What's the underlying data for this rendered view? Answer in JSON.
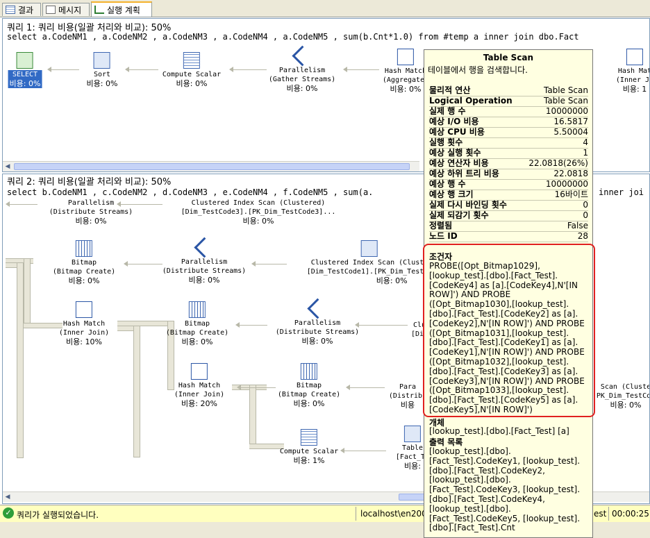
{
  "tabs": [
    {
      "label": "결과",
      "icon": "grid-icon"
    },
    {
      "label": "메시지",
      "icon": "message-icon"
    },
    {
      "label": "실행 계획",
      "icon": "plan-icon"
    }
  ],
  "query1": {
    "header": "쿼리 1: 쿼리 비용(일괄 처리와 비교): 50%",
    "sql": "select a.CodeNM1 , a.CodeNM2 , a.CodeNM3 , a.CodeNM4 , a.CodeNM5 , sum(b.Cnt*1.0) from #temp a inner join dbo.Fact",
    "nodes": [
      {
        "name": "SELECT",
        "cost": "비용: 0%",
        "icon": "select-icon"
      },
      {
        "name": "Sort",
        "cost": "비용: 0%",
        "icon": "sort-icon"
      },
      {
        "name": "Compute Scalar",
        "cost": "비용: 0%",
        "icon": "compute-scalar-icon"
      },
      {
        "name": "Parallelism",
        "sub": "(Gather Streams)",
        "cost": "비용: 0%",
        "icon": "parallelism-icon"
      },
      {
        "name": "Hash Match",
        "sub": "(Aggregate)",
        "cost": "비용: 0%",
        "icon": "hash-match-icon"
      },
      {
        "name": "Hash Mat",
        "sub": "(Inner Jo",
        "cost": "비용: 1",
        "icon": "hash-match-icon"
      }
    ]
  },
  "query2": {
    "header": "쿼리 2: 쿼리 비용(일괄 처리와 비교): 50%",
    "sql": "select b.CodeNM1 , c.CodeNM2 , d.CodeNM3 , e.CodeNM4 , f.CodeNM5 , sum(a.",
    "sql_tail": "inner joi",
    "nodes": {
      "par_top": {
        "name": "Parallelism",
        "sub": "(Distribute Streams)",
        "cost": "비용: 0%"
      },
      "cis_top": {
        "name": "Clustered Index Scan (Clustered)",
        "sub": "[Dim_TestCode3].[PK_Dim_TestCode3]...",
        "cost": "비용: 0%"
      },
      "bitmap1": {
        "name": "Bitmap",
        "sub": "(Bitmap Create)",
        "cost": "비용: 0%"
      },
      "par1": {
        "name": "Parallelism",
        "sub": "(Distribute Streams)",
        "cost": "비용: 0%"
      },
      "cis1": {
        "name": "Clustered Index Scan (Cluste",
        "sub": "[Dim_TestCode1].[PK_Dim_TestCo",
        "cost": "비용: 0%"
      },
      "hm1": {
        "name": "Hash Match",
        "sub": "(Inner Join)",
        "cost": "비용: 10%"
      },
      "bitmap2": {
        "name": "Bitmap",
        "sub": "(Bitmap Create)",
        "cost": "비용: 0%"
      },
      "par2": {
        "name": "Parallelism",
        "sub": "(Distribute Streams)",
        "cost": "비용: 0%"
      },
      "clu2": {
        "name": "Clu",
        "sub": "[Dim",
        "cost": ""
      },
      "hm2": {
        "name": "Hash Match",
        "sub": "(Inner Join)",
        "cost": "비용: 20%"
      },
      "bitmap3": {
        "name": "Bitmap",
        "sub": "(Bitmap Create)",
        "cost": "비용: 0%"
      },
      "para3": {
        "name": "Para",
        "sub": "(Distribu",
        "cost": "비용"
      },
      "scan_right": {
        "name": "Scan (Cluste",
        "sub": "PK_Dim_TestCod",
        "cost": "비용: 0%"
      },
      "cs": {
        "name": "Compute Scalar",
        "cost": "비용: 1%"
      },
      "table": {
        "name": "Table",
        "sub": "[Fact_Te",
        "cost": "비용:"
      }
    }
  },
  "tooltip": {
    "title": "Table Scan",
    "desc": "테이블에서 행을 검색합니다.",
    "rows": [
      {
        "k": "물리적 연산",
        "v": "Table Scan"
      },
      {
        "k": "Logical Operation",
        "v": "Table Scan"
      },
      {
        "k": "실제 행 수",
        "v": "10000000"
      },
      {
        "k": "예상 I/O 비용",
        "v": "16.5817"
      },
      {
        "k": "예상 CPU 비용",
        "v": "5.50004"
      },
      {
        "k": "실행 횟수",
        "v": "4"
      },
      {
        "k": "예상 실행 횟수",
        "v": "1"
      },
      {
        "k": "예상 연산자 비용",
        "v": "22.0818(26%)"
      },
      {
        "k": "예상 하위 트리 비용",
        "v": "22.0818"
      },
      {
        "k": "예상 행 수",
        "v": "10000000"
      },
      {
        "k": "예상 행 크기",
        "v": "16바이트"
      },
      {
        "k": "실제 다시 바인딩 횟수",
        "v": "0"
      },
      {
        "k": "실제 되감기 횟수",
        "v": "0"
      },
      {
        "k": "정렬됨",
        "v": "False"
      },
      {
        "k": "노드 ID",
        "v": "28"
      }
    ],
    "predicate_label": "조건자",
    "predicate": "PROBE([Opt_Bitmap1029], [lookup_test].[dbo].[Fact_Test]. [CodeKey4] as [a].[CodeKey4],N'[IN ROW]') AND PROBE ([Opt_Bitmap1030],[lookup_test]. [dbo].[Fact_Test].[CodeKey2] as [a]. [CodeKey2],N'[IN ROW]') AND PROBE ([Opt_Bitmap1031],[lookup_test]. [dbo].[Fact_Test].[CodeKey1] as [a]. [CodeKey1],N'[IN ROW]') AND PROBE ([Opt_Bitmap1032],[lookup_test]. [dbo].[Fact_Test].[CodeKey3] as [a]. [CodeKey3],N'[IN ROW]') AND PROBE ([Opt_Bitmap1033],[lookup_test]. [dbo].[Fact_Test].[CodeKey5] as [a]. [CodeKey5],N'[IN ROW]')",
    "object_label": "개체",
    "object": "[lookup_test].[dbo].[Fact_Test] [a]",
    "output_label": "출력 목록",
    "output": "[lookup_test].[dbo]. [Fact_Test].CodeKey1, [lookup_test]. [dbo].[Fact_Test].CodeKey2, [lookup_test].[dbo]. [Fact_Test].CodeKey3, [lookup_test]. [dbo].[Fact_Test].CodeKey4, [lookup_test].[dbo]. [Fact_Test].CodeKey5, [lookup_test]. [dbo].[Fact_Test].Cnt"
  },
  "status": {
    "message": "쿼리가 실행되었습니다.",
    "server": "localhost\\en200",
    "db": "est",
    "elapsed": "00:00:25"
  },
  "colors": {
    "accent": "#316ac5",
    "status_bg": "#ffffbf",
    "tooltip_bg": "#ffffe1",
    "highlight_border": "#e02020"
  }
}
